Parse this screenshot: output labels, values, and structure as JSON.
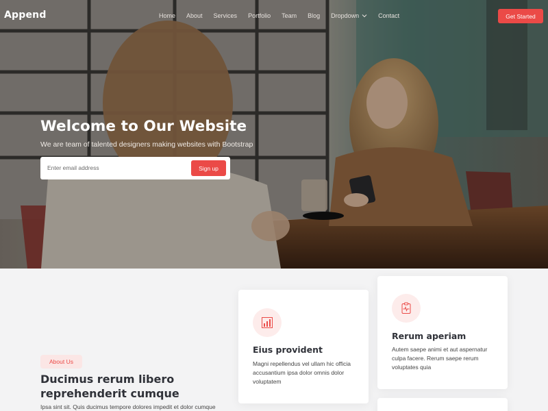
{
  "brand": {
    "logo": "Append"
  },
  "nav": {
    "items": [
      {
        "label": "Home"
      },
      {
        "label": "About"
      },
      {
        "label": "Services"
      },
      {
        "label": "Portfolio"
      },
      {
        "label": "Team"
      },
      {
        "label": "Blog"
      },
      {
        "label": "Dropdown"
      },
      {
        "label": "Contact"
      }
    ],
    "cta_label": "Get Started"
  },
  "hero": {
    "title": "Welcome to Our Website",
    "subtitle": "We are team of talented designers making websites with Bootstrap",
    "email_placeholder": "Enter email address",
    "signup_label": "Sign up"
  },
  "about": {
    "badge": "About Us",
    "title": "Ducimus rerum libero reprehenderit cumque",
    "text": "Ipsa sint sit. Quis ducimus tempore dolores impedit et dolor cumque"
  },
  "cards": [
    {
      "icon": "chart-bars-icon",
      "title": "Eius provident",
      "text": "Magni repellendus vel ullam hic officia accusantium ipsa dolor omnis dolor voluptatem"
    },
    {
      "icon": "clipboard-pulse-icon",
      "title": "Rerum aperiam",
      "text": "Autem saepe animi et aut aspernatur culpa facere. Rerum saepe rerum voluptates quia"
    }
  ],
  "colors": {
    "accent": "#eb4a47",
    "accent_light": "#fdeceb",
    "heading": "#2f3138",
    "section_bg": "#f3f3f4"
  }
}
